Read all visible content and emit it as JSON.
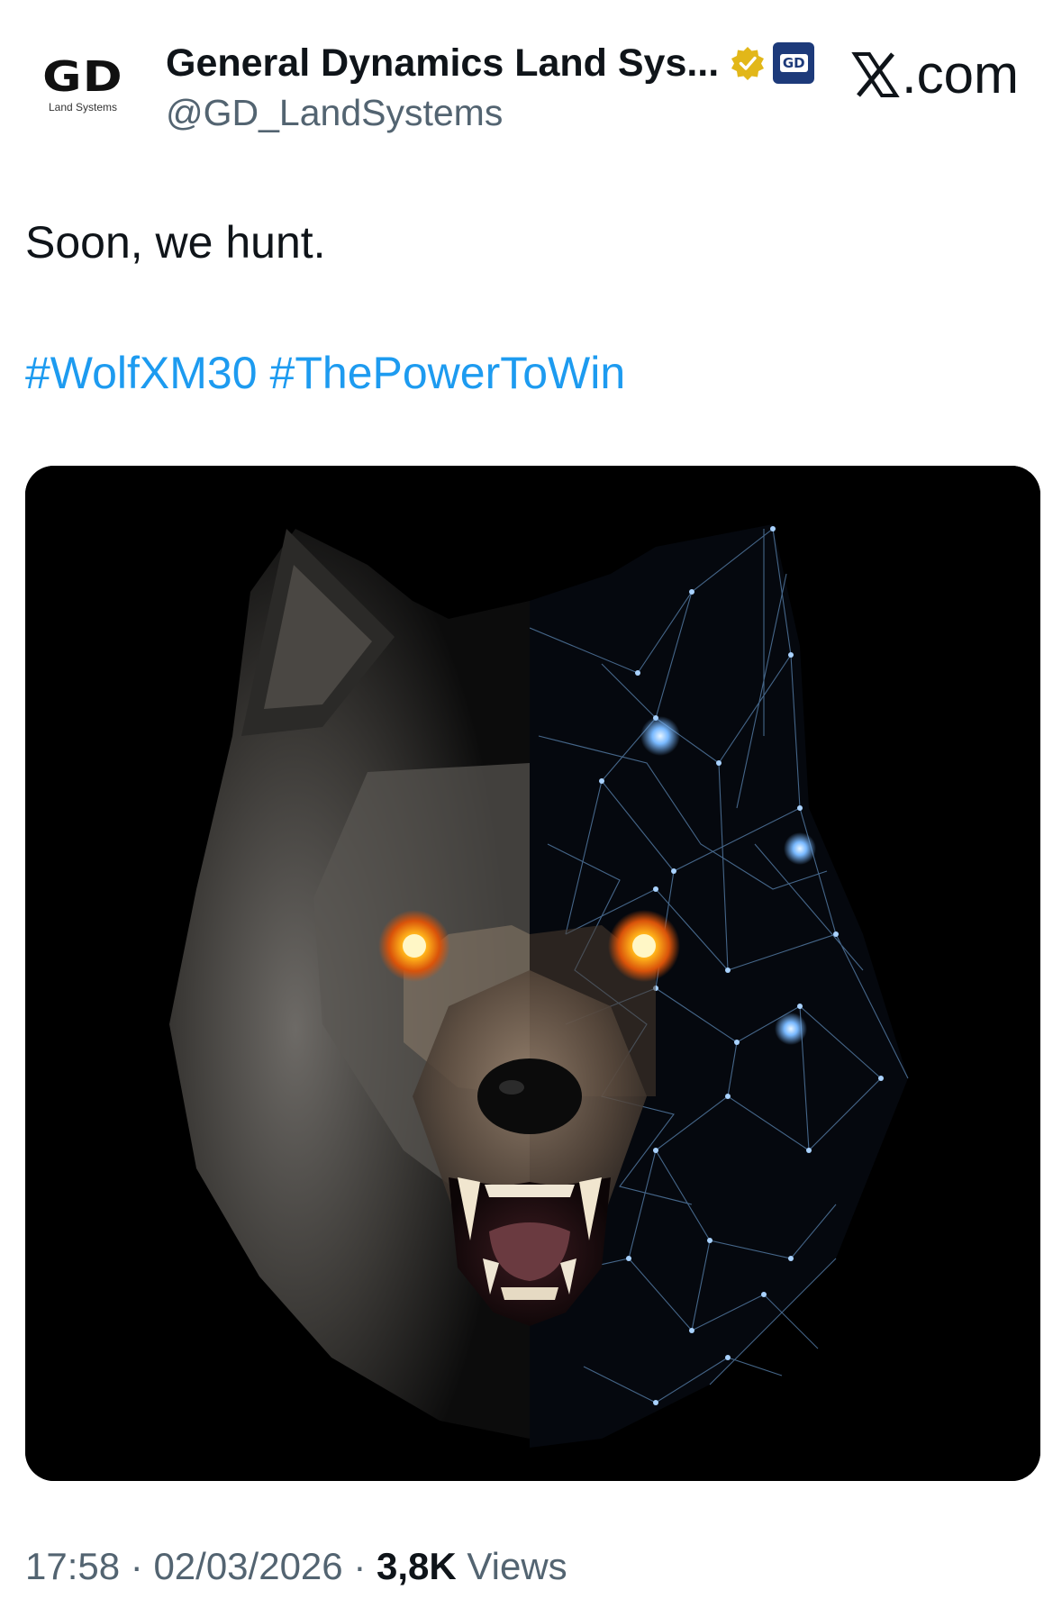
{
  "author": {
    "display_name": "General Dynamics Land Sys...",
    "handle": "@GD_LandSystems",
    "avatar_logo": "GD",
    "avatar_subtitle": "Land Systems",
    "verified_badge_color": "#e2b719",
    "affiliate_badge": "GD"
  },
  "site": {
    "label": ".com",
    "icon": "x-logo-icon"
  },
  "tweet": {
    "text": "Soon, we hunt.",
    "hashtags": [
      "#WolfXM30",
      "#ThePowerToWin"
    ],
    "hashtag_color": "#1d9bf0",
    "media": {
      "icon": "wolf-image"
    }
  },
  "meta": {
    "time": "17:58",
    "separator": " · ",
    "date": "02/03/2026",
    "views_count": "3,8K",
    "views_label": " Views"
  }
}
